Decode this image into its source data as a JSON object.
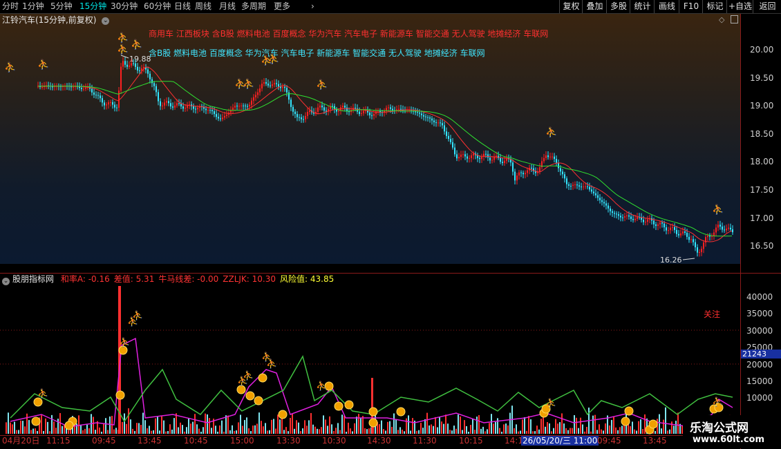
{
  "toolbar": {
    "periods": [
      "分时",
      "1分钟",
      "5分钟",
      "15分钟",
      "30分钟",
      "60分钟",
      "日线",
      "周线",
      "月线",
      "多周期",
      "更多"
    ],
    "active_period": "15分钟",
    "buttons": [
      "复权",
      "叠加",
      "多股",
      "统计",
      "画线",
      "F10",
      "标记",
      "+自选",
      "返回"
    ]
  },
  "main_pane": {
    "title": "江铃汽车(15分钟,前复权)",
    "concepts_line1": "商用车 江西板块 含B股 燃料电池 百度概念 华为汽车 汽车电子 新能源车 智能交通 无人驾驶 地摊经济 车联网",
    "concepts_line2": "含B股 燃料电池 百度概念 华为汽车 汽车电子 新能源车 智能交通 无人驾驶 地摊经济 车联网",
    "high_label": "19.88",
    "low_label": "16.26",
    "price_axis": [
      "20.00",
      "19.50",
      "19.00",
      "18.50",
      "18.00",
      "17.50",
      "17.00",
      "16.50"
    ]
  },
  "indicator_pane": {
    "name": "股朋指标网",
    "values": [
      {
        "label": "和率A: -0.16",
        "color": "#ff3333"
      },
      {
        "label": "差值: 5.31",
        "color": "#ff3333"
      },
      {
        "label": "牛马线差: -0.00",
        "color": "#ff3333"
      },
      {
        "label": "ZZLJK: 10.30",
        "color": "#ff3333"
      },
      {
        "label": "风险值: 43.85",
        "color": "#ffff33"
      }
    ],
    "attention_label": "关注",
    "axis": [
      "40000",
      "35000",
      "30000",
      "25000",
      "20000",
      "15000",
      "10000"
    ],
    "current_value": "21243"
  },
  "time_axis": [
    "04月20日",
    "11:15",
    "09:45",
    "13:45",
    "10:45",
    "15:00",
    "13:30",
    "10:30",
    "14:30",
    "11:30",
    "10:15",
    "14:1",
    "26/05/20/三 11:00",
    "09:45",
    "13:45"
  ],
  "watermark": {
    "title": "乐淘公式网",
    "url": "www.60lt.com"
  },
  "colors": {
    "up": "#ff2020",
    "down": "#33e6ff",
    "ma_fast": "#ff3030",
    "ma_slow": "#30e030",
    "magenta": "#e020e0",
    "green_line": "#40c040",
    "axis_red": "#8b1a1a",
    "coin": "#f0a000"
  }
}
